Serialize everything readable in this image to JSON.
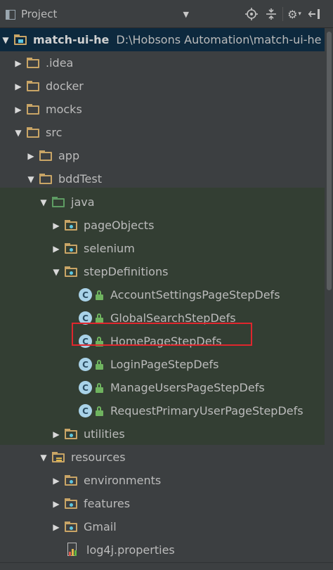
{
  "toolbar": {
    "view_label": "Project",
    "icons": [
      "project-pane-icon",
      "dropdown-chevron-icon",
      "locate-icon",
      "collapse-all-icon",
      "gear-icon",
      "hide-icon"
    ]
  },
  "tree": {
    "root": {
      "name": "match-ui-he",
      "path": "D:\\Hobsons Automation\\match-ui-he"
    },
    "idea": ".idea",
    "docker": "docker",
    "mocks": "mocks",
    "src": "src",
    "app": "app",
    "bddTest": "bddTest",
    "java": "java",
    "pageObjects": "pageObjects",
    "selenium": "selenium",
    "stepDefinitions": "stepDefinitions",
    "classes": [
      "AccountSettingsPageStepDefs",
      "GlobalSearchStepDefs",
      "HomePageStepDefs",
      "LoginPageStepDefs",
      "ManageUsersPageStepDefs",
      "RequestPrimaryUserPageStepDefs"
    ],
    "class_badge": "C",
    "utilities": "utilities",
    "resources": "resources",
    "environments": "environments",
    "features": "features",
    "gmail": "Gmail",
    "log4j": "log4j.properties"
  },
  "colors": {
    "background": "#3c3f41",
    "selected_row": "#0d293e",
    "folder": "#c9a566",
    "source_folder": "#5e9c63",
    "highlight_box": "#e0262d"
  }
}
